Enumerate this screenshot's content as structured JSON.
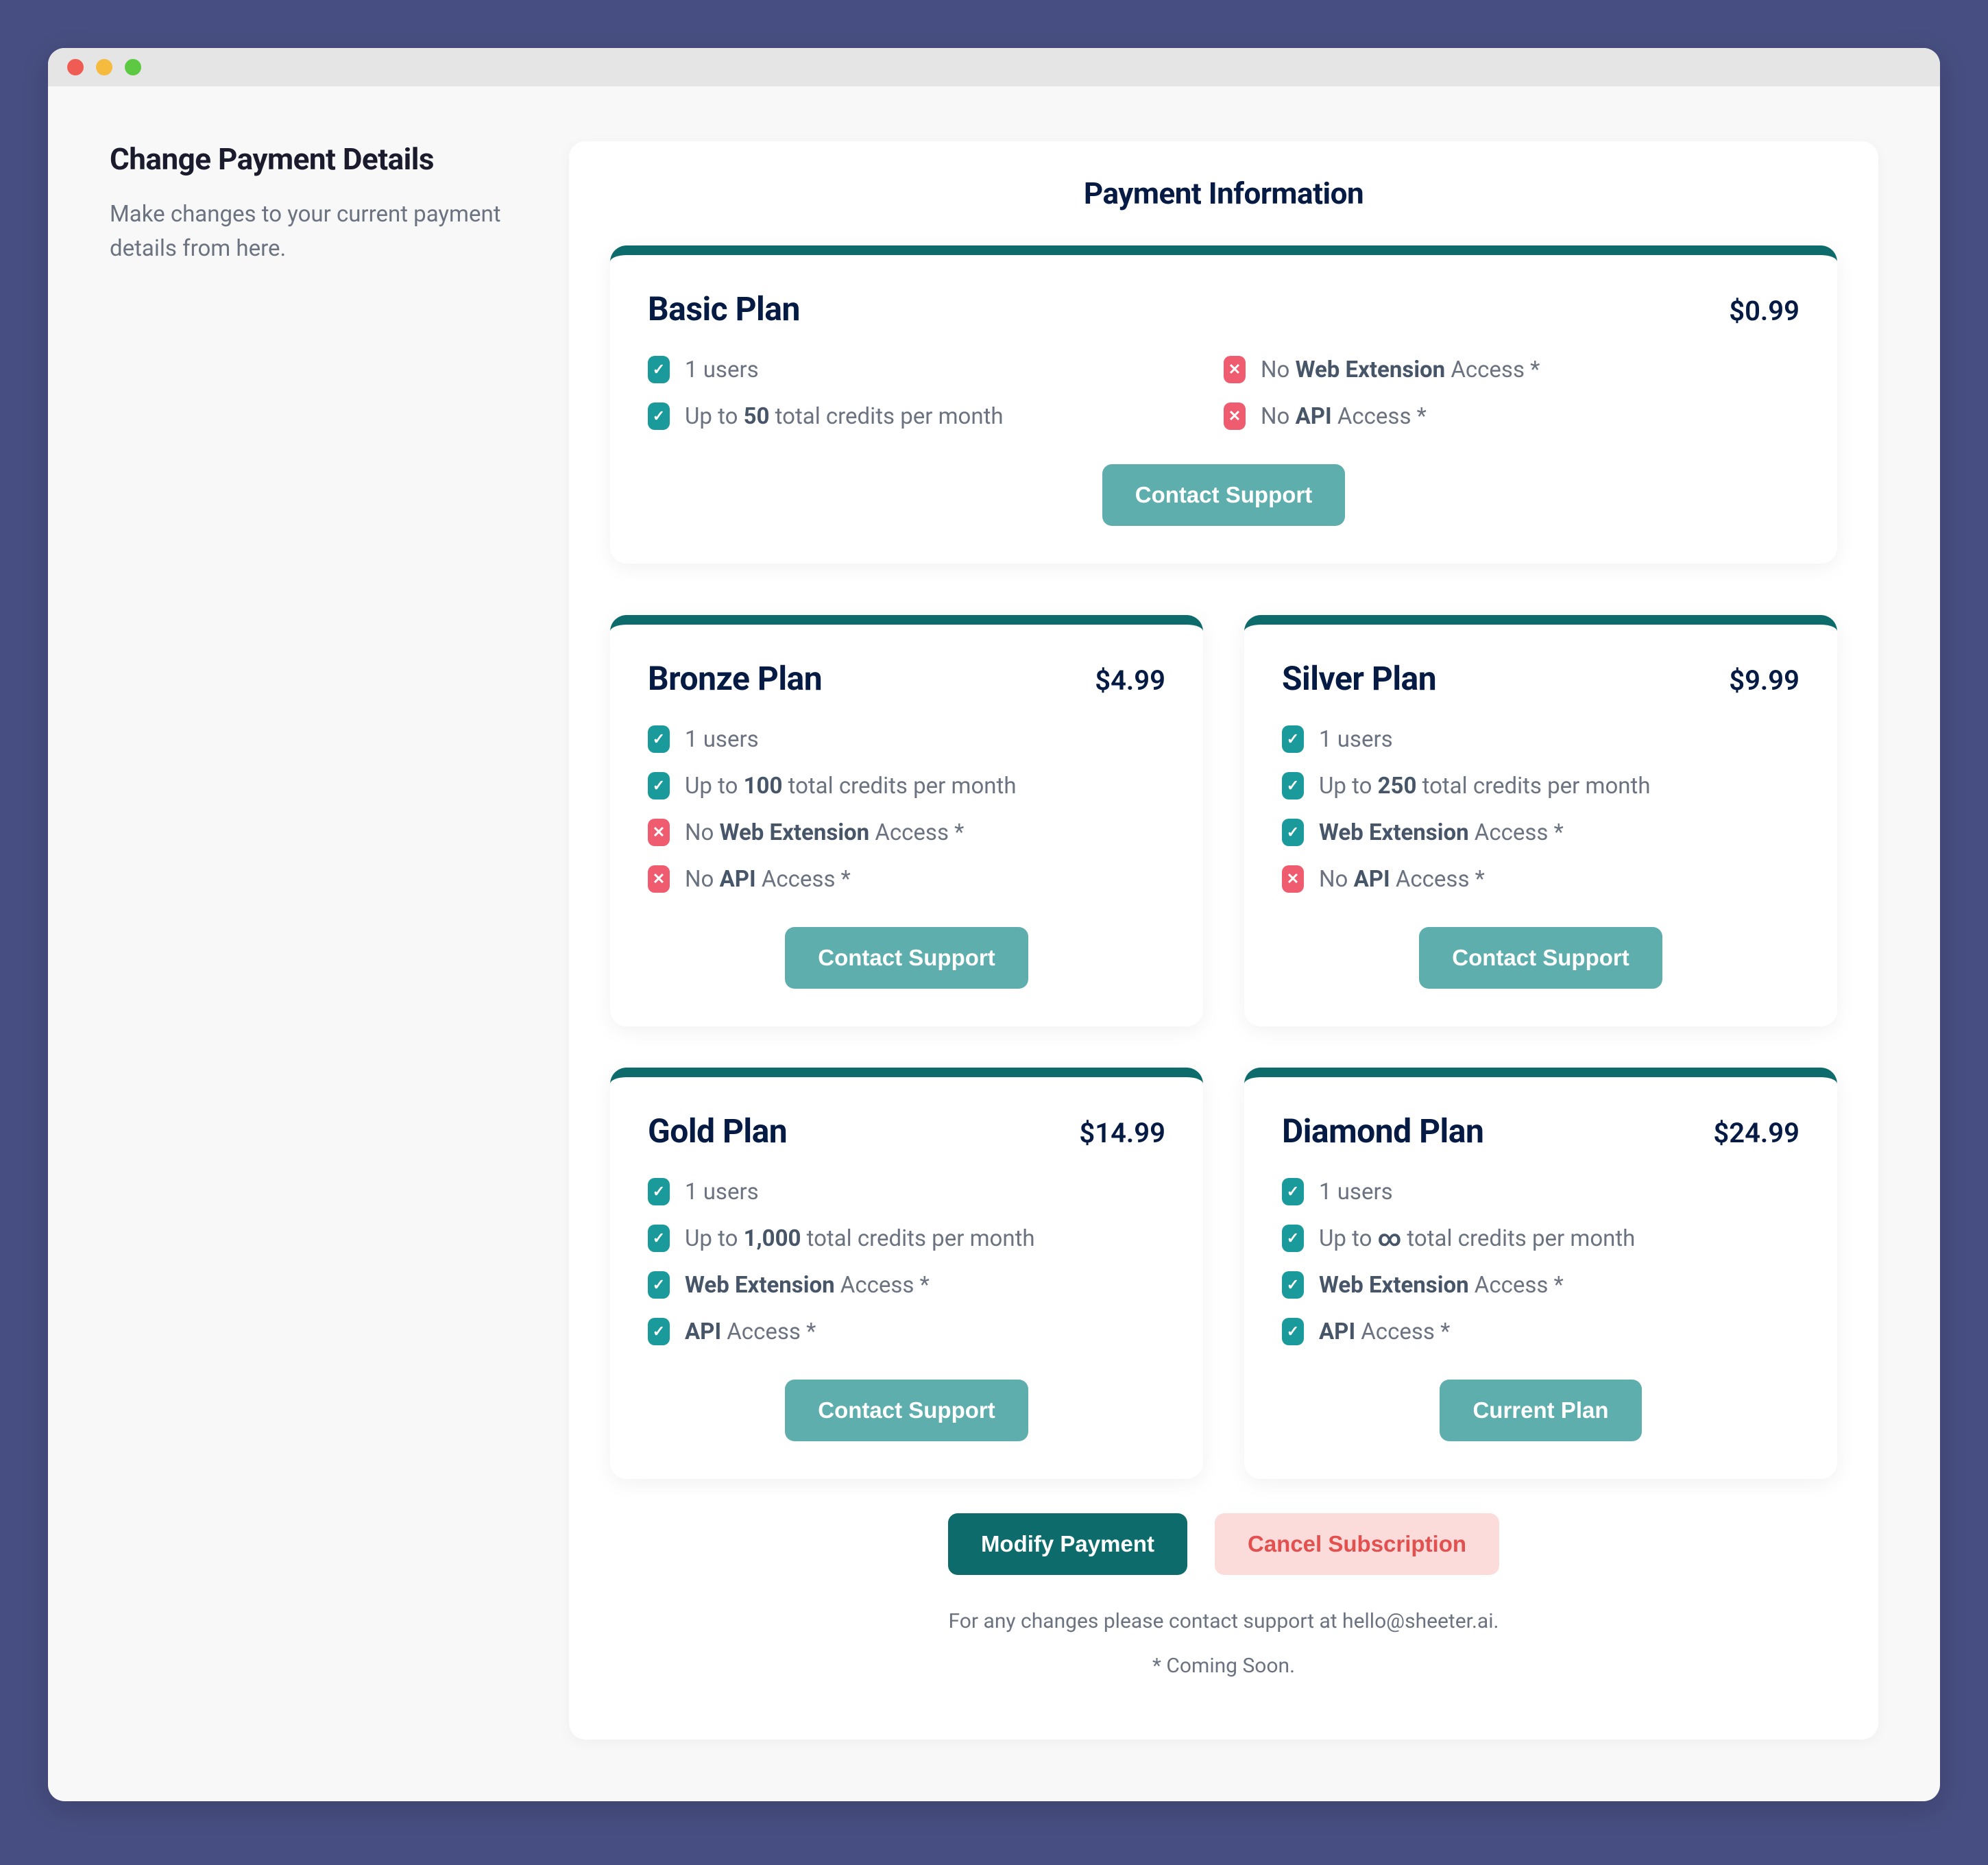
{
  "sidebar": {
    "title": "Change Payment Details",
    "desc": "Make changes to your current payment details from here."
  },
  "page": {
    "title": "Payment Information"
  },
  "labels": {
    "contact_support": "Contact Support",
    "current_plan": "Current Plan",
    "modify_payment": "Modify Payment",
    "cancel_subscription": "Cancel Subscription"
  },
  "footnotes": {
    "support": "For any changes please contact support at hello@sheeter.ai.",
    "coming_soon": "* Coming Soon."
  },
  "plans": {
    "basic": {
      "name": "Basic Plan",
      "price": "$0.99",
      "f1a": "1",
      "f1b": " users",
      "f2a": "Up to ",
      "f2b": "50",
      "f2c": " total credits per month",
      "f3a": "No ",
      "f3b": "Web Extension",
      "f3c": " Access *",
      "f4a": "No ",
      "f4b": "API",
      "f4c": " Access *"
    },
    "bronze": {
      "name": "Bronze Plan",
      "price": "$4.99",
      "f1a": "1",
      "f1b": " users",
      "f2a": "Up to ",
      "f2b": "100",
      "f2c": " total credits per month",
      "f3a": "No ",
      "f3b": "Web Extension",
      "f3c": " Access *",
      "f4a": "No ",
      "f4b": "API",
      "f4c": " Access *"
    },
    "silver": {
      "name": "Silver Plan",
      "price": "$9.99",
      "f1a": "1",
      "f1b": " users",
      "f2a": "Up to ",
      "f2b": "250",
      "f2c": " total credits per month",
      "f3b": "Web Extension",
      "f3c": " Access *",
      "f4a": "No ",
      "f4b": "API",
      "f4c": " Access *"
    },
    "gold": {
      "name": "Gold Plan",
      "price": "$14.99",
      "f1a": "1",
      "f1b": " users",
      "f2a": "Up to ",
      "f2b": "1,000",
      "f2c": " total credits per month",
      "f3b": "Web Extension",
      "f3c": " Access *",
      "f4b": "API",
      "f4c": " Access *"
    },
    "diamond": {
      "name": "Diamond Plan",
      "price": "$24.99",
      "f1a": "1",
      "f1b": " users",
      "f2a": "Up to ",
      "f2b": "∞",
      "f2c": " total credits per month",
      "f3b": "Web Extension",
      "f3c": " Access *",
      "f4b": "API",
      "f4c": " Access *"
    }
  }
}
